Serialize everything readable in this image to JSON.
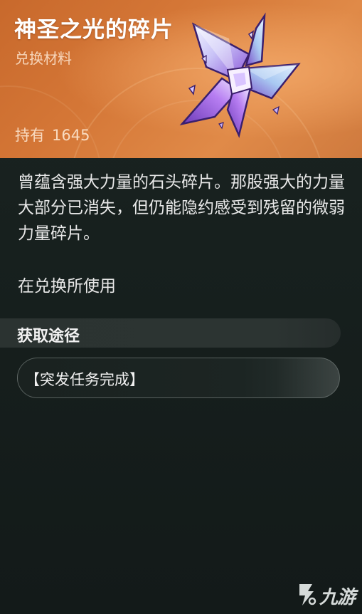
{
  "item": {
    "title": "神圣之光的碎片",
    "category": "兑换材料",
    "owned_label": "持有",
    "owned_count": "1645",
    "icon": "crystal-shard-icon"
  },
  "description": "曾蕴含强大力量的石头碎片。那股强大的力量大部分已消失，但仍能隐约感受到残留的微弱力量碎片。",
  "usage": "在兑换所使用",
  "sources": {
    "title": "获取途径",
    "items": [
      {
        "label": "【突发任务完成】"
      }
    ]
  },
  "watermark": {
    "text": "九游",
    "icon": "jiuyou-logo-icon"
  },
  "colors": {
    "header_orange": "#d47636",
    "background": "#17201e",
    "crystal_purple": "#a77df0"
  }
}
